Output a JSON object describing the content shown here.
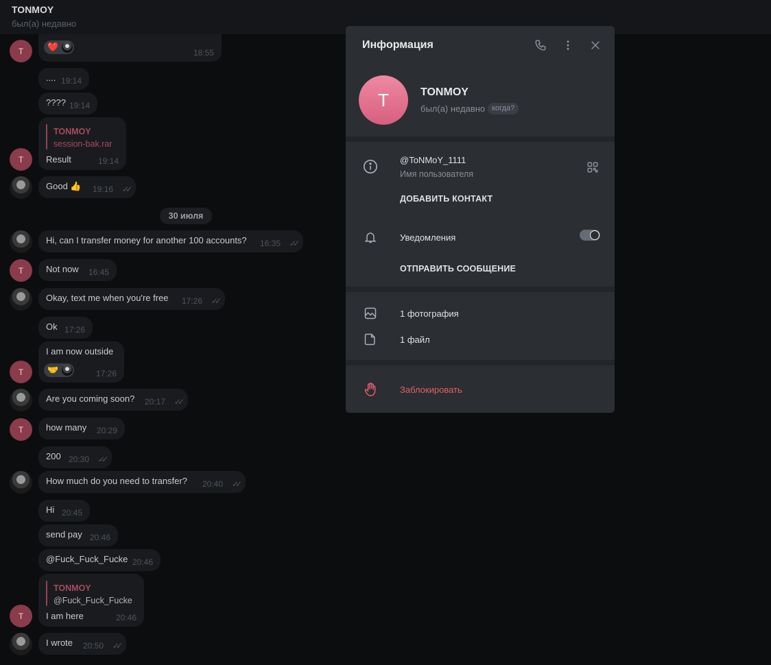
{
  "header": {
    "name": "TONMOY",
    "status": "был(а) недавно"
  },
  "date_separator": "30 июля",
  "messages": [
    {
      "time": "18:55"
    },
    {
      "text": "....",
      "time": "19:14"
    },
    {
      "text": "????",
      "time": "19:14"
    },
    {
      "reply_name": "TONMOY",
      "reply_text": "session-bak.rar",
      "text": "Result",
      "time": "19:14"
    },
    {
      "text": "Good 👍",
      "time": "19:16"
    },
    {
      "text": "Hi, can I transfer money for another 100 accounts?",
      "time": "16:35"
    },
    {
      "text": "Not now",
      "time": "16:45"
    },
    {
      "text": "Okay, text me when you're free",
      "time": "17:26"
    },
    {
      "text": "Ok",
      "time": "17:26"
    },
    {
      "text": "I am now outside",
      "time": "17:26"
    },
    {
      "text": "Are you coming soon?",
      "time": "20:17"
    },
    {
      "text": "how many",
      "time": "20:29"
    },
    {
      "text": "200",
      "time": "20:30"
    },
    {
      "text": "How much do you need to transfer?",
      "time": "20:40"
    },
    {
      "text": "Hi",
      "time": "20:45"
    },
    {
      "text": "send pay",
      "time": "20:46"
    },
    {
      "text": "@Fuck_Fuck_Fucke",
      "time": "20:46"
    },
    {
      "reply_name": "TONMOY",
      "reply_text": "@Fuck_Fuck_Fucke",
      "text": "I am here",
      "time": "20:46"
    },
    {
      "text": "I wrote",
      "time": "20:50"
    }
  ],
  "avatar_letter": "T",
  "read_checks": "✓✓",
  "reactions": {
    "heart": "❤️",
    "handshake": "🤝"
  },
  "info_panel": {
    "title": "Информация",
    "avatar_letter": "T",
    "name": "TONMOY",
    "status": "был(а) недавно",
    "when_label": "когда?",
    "username": "@ToNMoY_1111",
    "username_caption": "Имя пользователя",
    "add_contact": "ДОБАВИТЬ КОНТАКТ",
    "notifications": "Уведомления",
    "notifications_on": true,
    "send_message": "ОТПРАВИТЬ СООБЩЕНИЕ",
    "photos": "1 фотография",
    "files": "1 файл",
    "block": "Заблокировать"
  },
  "colors": {
    "accent_red": "#e0606a",
    "avatar_pink": "#e8728f",
    "bubble": "#191b1f",
    "panel": "#2b2e33"
  }
}
